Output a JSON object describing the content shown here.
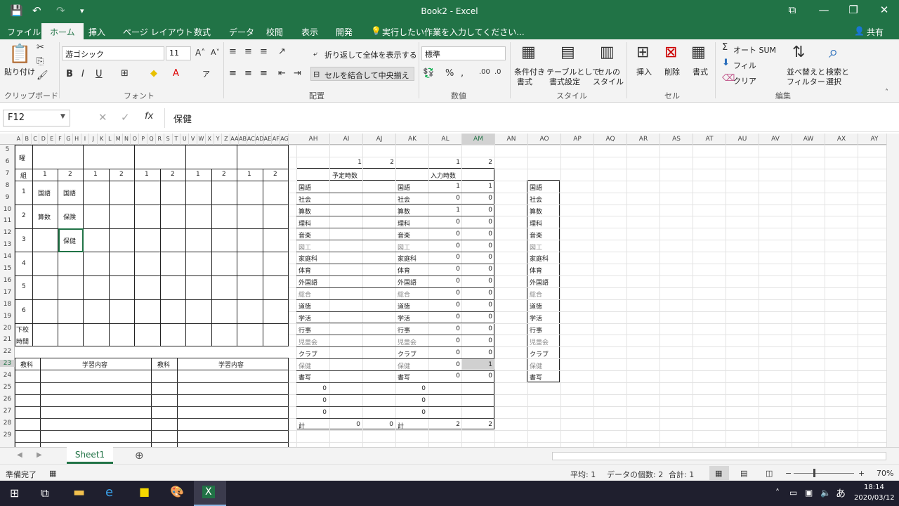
{
  "window": {
    "title": "Book2 - Excel"
  },
  "qat": {
    "save": "💾",
    "undo": "↶",
    "redo": "↷",
    "more": "▾"
  },
  "controls": {
    "display": "⧉",
    "minimize": "—",
    "restore": "❐",
    "close": "✕"
  },
  "tabs": [
    "ファイル",
    "ホーム",
    "挿入",
    "ページ レイアウト",
    "数式",
    "データ",
    "校閲",
    "表示",
    "開発"
  ],
  "tellme": "実行したい作業を入力してください...",
  "share": "共有",
  "ribbon": {
    "paste": "貼り付け",
    "clipboard": "クリップボード",
    "font_name": "游ゴシック",
    "font_size": "11",
    "font_group": "フォント",
    "bold": "B",
    "italic": "I",
    "underline": "U",
    "wrap": "折り返して全体を表示する",
    "merge": "セルを結合して中央揃え",
    "align_group": "配置",
    "num_format": "標準",
    "num_group": "数値",
    "cond_format": [
      "条件付き",
      "書式"
    ],
    "table_format": [
      "テーブルとして",
      "書式設定"
    ],
    "cell_style": [
      "セルの",
      "スタイル"
    ],
    "style_group": "スタイル",
    "insert": "挿入",
    "delete": "削除",
    "format": "書式",
    "cells_group": "セル",
    "autosum": "オート SUM",
    "fill": "フィル",
    "clear": "クリア",
    "sort": [
      "並べ替えと",
      "フィルター"
    ],
    "find": [
      "検索と",
      "選択"
    ],
    "edit_group": "編集"
  },
  "formula": {
    "name_box": "F12",
    "content": "保健"
  },
  "columns_left": [
    "A",
    "B",
    "C",
    "D",
    "E",
    "F",
    "G",
    "H",
    "I",
    "J",
    "K",
    "L",
    "M",
    "N",
    "O",
    "P",
    "Q",
    "R",
    "S",
    "T",
    "U",
    "V",
    "W",
    "X",
    "Y",
    "Z",
    "AA",
    "AB",
    "AC",
    "AD",
    "AE",
    "AF",
    "AG"
  ],
  "columns_right": [
    "AH",
    "AI",
    "AJ",
    "AK",
    "AL",
    "AM",
    "AN",
    "AO",
    "AP",
    "AQ",
    "AR",
    "AS",
    "AT",
    "AU",
    "AV",
    "AW",
    "AX",
    "AY"
  ],
  "rows": [
    "5",
    "6",
    "7",
    "8",
    "9",
    "10",
    "11",
    "12",
    "13",
    "14",
    "15",
    "16",
    "17",
    "18",
    "19",
    "20",
    "21",
    "22",
    "23",
    "24",
    "25",
    "26",
    "27",
    "28",
    "29"
  ],
  "timetable": {
    "yobi": "曜",
    "kumi": "組",
    "nums": [
      "1",
      "2",
      "1",
      "2",
      "1",
      "2",
      "1",
      "2",
      "1",
      "2"
    ],
    "periods": [
      "1",
      "2",
      "3",
      "4",
      "5",
      "6"
    ],
    "after_school": [
      "下校",
      "時間"
    ],
    "cells": {
      "p1c1": "国語",
      "p1c2": "国語",
      "p2c1": "算数",
      "p2c2": "保険",
      "p3c2": "保健"
    },
    "kyoka": "教科",
    "gakushu": "学習内容"
  },
  "summary": {
    "top_nums": [
      "1",
      "2",
      "1",
      "2"
    ],
    "yotei": "予定時数",
    "nyuryoku": "入力時数",
    "subjects": [
      "国語",
      "社会",
      "算数",
      "理科",
      "音楽",
      "図工",
      "家庭科",
      "体育",
      "外国語",
      "総合",
      "道徳",
      "学活",
      "行事",
      "児童会",
      "クラブ",
      "保健",
      "書写"
    ],
    "al": [
      "1",
      "0",
      "1",
      "0",
      "0",
      "0",
      "0",
      "0",
      "0",
      "0",
      "0",
      "0",
      "0",
      "0",
      "0",
      "0",
      "0"
    ],
    "am": [
      "1",
      "0",
      "0",
      "0",
      "0",
      "0",
      "0",
      "0",
      "0",
      "0",
      "0",
      "0",
      "0",
      "0",
      "0",
      "1",
      "0"
    ],
    "zeros": [
      "0",
      "0",
      "0"
    ],
    "total_label": "計",
    "total_ai": "0",
    "total_aj": "0",
    "total_al": "2",
    "total_am": "2"
  },
  "sheet_tab": "Sheet1",
  "status": {
    "ready": "準備完了",
    "avg": "平均: 1",
    "count": "データの個数: 2",
    "sum": "合計: 1",
    "zoom": "70%"
  },
  "taskbar": {
    "time": "18:14",
    "date": "2020/03/12",
    "ime": "あ"
  }
}
